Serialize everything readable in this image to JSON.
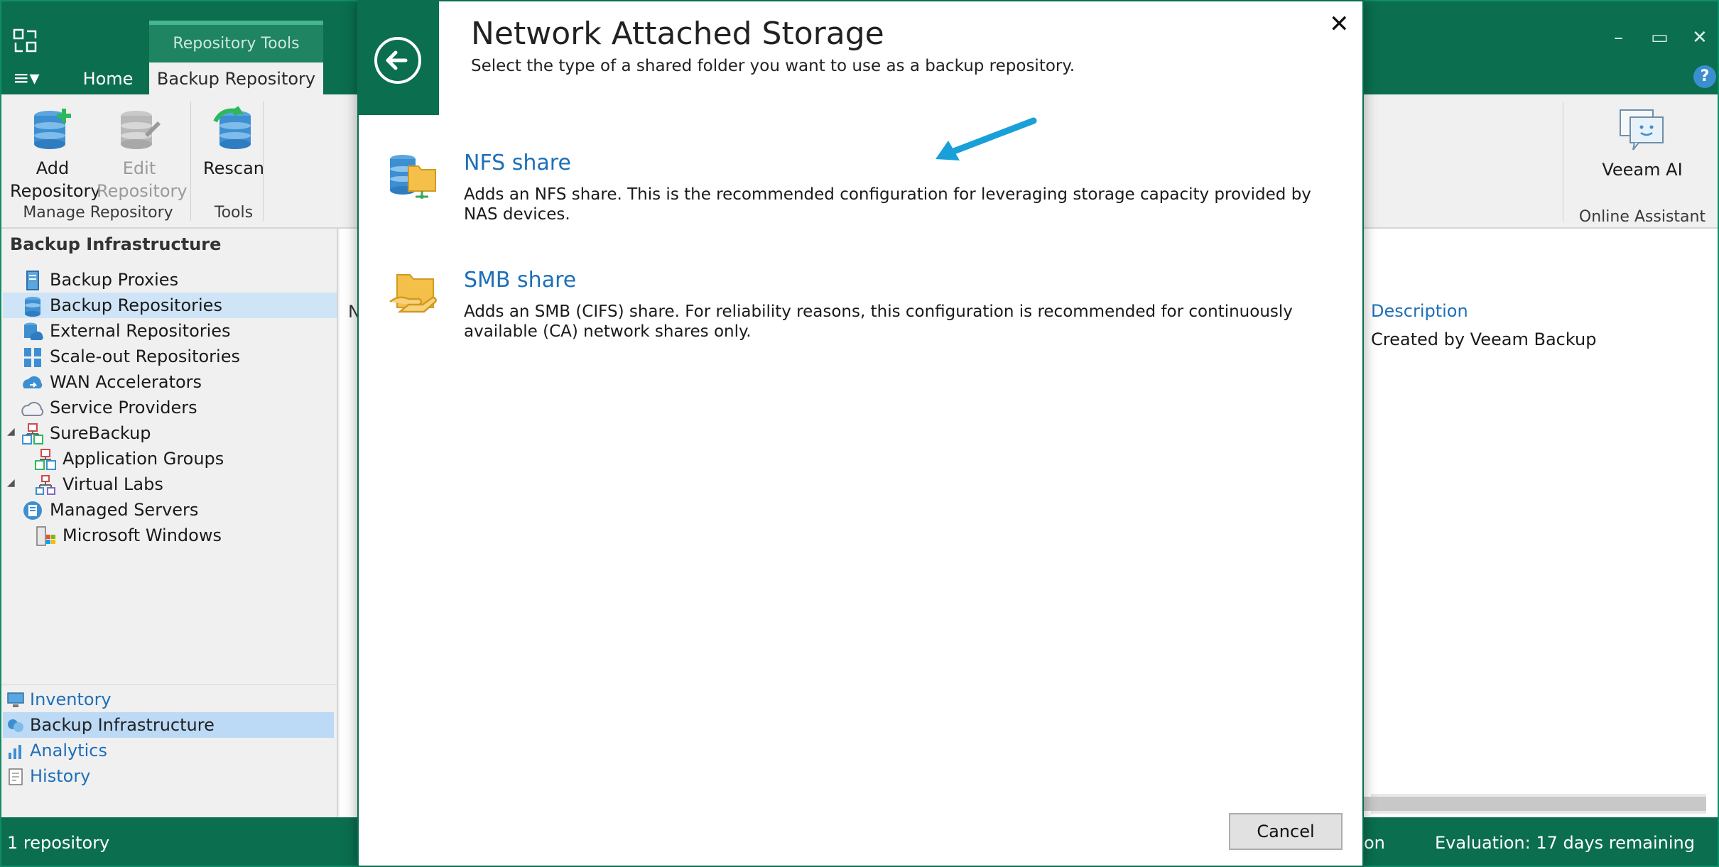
{
  "titlebar": {
    "context_group": "Repository Tools",
    "tabs": [
      "Home",
      "Backup Repository"
    ],
    "menu_glyph": "≡▾",
    "window_controls": [
      "–",
      "▭",
      "✕"
    ],
    "help_glyph": "?"
  },
  "ribbon": {
    "add_repository": "Add Repository",
    "edit_repository": "Edit Repository",
    "rescan": "Rescan",
    "group_manage": "Manage Repository",
    "group_tools": "Tools",
    "veeam_ai": "Veeam AI",
    "group_online_assistant": "Online Assistant"
  },
  "leftnav": {
    "header": "Backup Infrastructure",
    "items": [
      {
        "label": "Backup Proxies",
        "icon": "proxy-icon"
      },
      {
        "label": "Backup Repositories",
        "icon": "repository-icon",
        "selected": true
      },
      {
        "label": "External Repositories",
        "icon": "cloud-repository-icon"
      },
      {
        "label": "Scale-out Repositories",
        "icon": "scaleout-icon"
      },
      {
        "label": "WAN Accelerators",
        "icon": "wan-icon"
      },
      {
        "label": "Service Providers",
        "icon": "cloud-icon"
      },
      {
        "label": "SureBackup",
        "icon": "surebackup-icon",
        "expandable": true
      },
      {
        "label": "Application Groups",
        "icon": "app-group-icon",
        "indent": true
      },
      {
        "label": "Virtual Labs",
        "icon": "virtual-lab-icon",
        "indent": true
      },
      {
        "label": "Managed Servers",
        "icon": "managed-servers-icon",
        "expandable": true
      },
      {
        "label": "Microsoft Windows",
        "icon": "windows-icon",
        "indent": true
      }
    ],
    "bottom": [
      {
        "label": "Inventory",
        "icon": "inventory-icon"
      },
      {
        "label": "Backup Infrastructure",
        "icon": "infrastructure-icon",
        "selected": true
      },
      {
        "label": "Analytics",
        "icon": "analytics-icon"
      },
      {
        "label": "History",
        "icon": "history-icon"
      }
    ]
  },
  "main": {
    "description_header": "Description",
    "description_value": "Created by Veeam Backup",
    "truncated_letter": "N"
  },
  "statusbar": {
    "left": "1 repository",
    "middle_fragment": "on",
    "right": "Evaluation: 17 days remaining"
  },
  "dialog": {
    "title": "Network Attached Storage",
    "subtitle": "Select the type of a shared folder you want to use as a backup repository.",
    "options": [
      {
        "title": "NFS share",
        "description": "Adds an NFS share. This is the recommended configuration for leveraging storage capacity provided by NAS devices.",
        "icon": "nfs-share-icon"
      },
      {
        "title": "SMB share",
        "description": "Adds an SMB (CIFS) share. For reliability reasons, this configuration is recommended for continuously available (CA) network shares only.",
        "icon": "smb-share-icon"
      }
    ],
    "cancel_label": "Cancel",
    "close_glyph": "✕"
  },
  "colors": {
    "brand_green": "#0a6e4f",
    "link_blue": "#1e6fb8",
    "selection_blue": "#cfe4f7",
    "annotation_arrow": "#1aa0d8"
  }
}
